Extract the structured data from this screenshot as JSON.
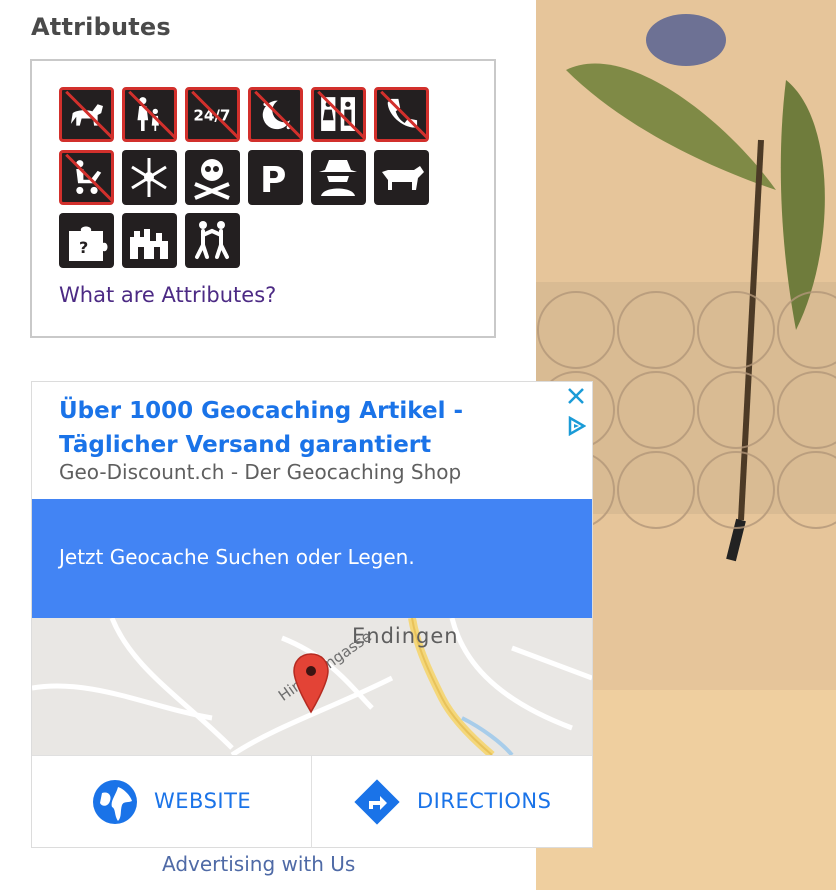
{
  "attributes": {
    "title": "Attributes",
    "link": "What are Attributes?",
    "icons": [
      "no-dogs-icon",
      "no-kids-icon",
      "no-24-7-icon",
      "no-night-icon",
      "no-restrooms-icon",
      "no-phone-icon",
      "no-stroller-icon",
      "winter-icon",
      "dangerous-icon",
      "parking-icon",
      "stealth-icon",
      "cattle-icon",
      "puzzle-icon",
      "ruins-icon",
      "kids-icon"
    ]
  },
  "ad": {
    "title": "Über 1000 Geocaching Artikel - Täglicher Versand garantiert",
    "subtitle": "Geo-Discount.ch - Der Geocaching Shop",
    "band_text": "Jetzt Geocache Suchen oder Legen.",
    "map": {
      "town": "Endingen",
      "street": "Hirschengasse"
    },
    "buttons": {
      "website": "WEBSITE",
      "directions": "DIRECTIONS"
    },
    "footer": "Advertising with Us"
  },
  "colors": {
    "ad_blue": "#4284f4",
    "link_blue": "#1a73e8",
    "prohibited_red": "#d2302c"
  }
}
